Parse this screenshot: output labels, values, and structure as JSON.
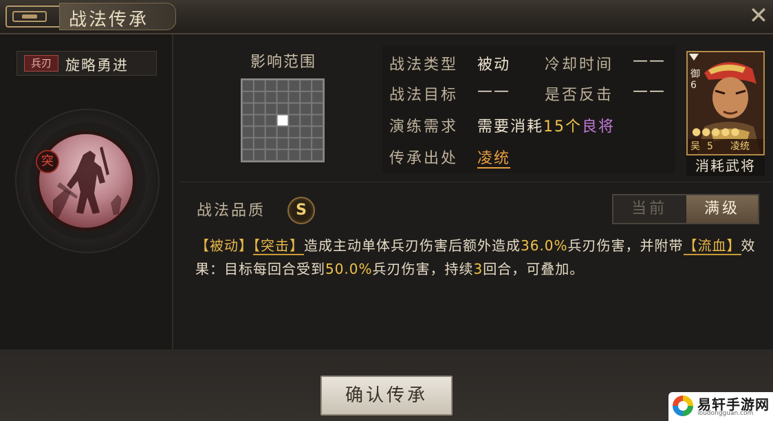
{
  "window": {
    "title": "战法传承"
  },
  "skill": {
    "type_tag": "兵刃",
    "name": "旋略勇进",
    "badge": "突"
  },
  "range": {
    "label": "影响范围",
    "grid_rows": 7,
    "grid_cols": 7,
    "highlight_cell": [
      3,
      3
    ]
  },
  "props": {
    "type_label": "战法类型",
    "type_value": "被动",
    "cooldown_label": "冷却时间",
    "cooldown_value": "——",
    "target_label": "战法目标",
    "target_value": "——",
    "counter_label": "是否反击",
    "counter_value": "——",
    "train_label": "演练需求",
    "train_prefix": "需要消耗",
    "train_count": "15个",
    "train_item": "良将",
    "source_label": "传承出处",
    "source_value": "凌统"
  },
  "general_card": {
    "faction_label": "御",
    "cost": "6",
    "stars": "●●●●●",
    "camp": "吴",
    "level": "5",
    "name": "凌统",
    "caption": "消耗武将"
  },
  "quality": {
    "label": "战法品质",
    "grade": "S"
  },
  "toggle": {
    "current": "当前",
    "max": "满级",
    "selected": "满级"
  },
  "description": {
    "tag1": "【被动】",
    "tag2": "【突击】",
    "part1": "造成主动单体兵刃伤害后额外造成",
    "val1": "36.0%",
    "part2": "兵刃伤害，并附带",
    "tag3": "【流血】",
    "part3": "效果：目标每回合受到",
    "val2": "50.0%",
    "part4": "兵刃伤害，持续",
    "val3": "3",
    "part5": "回合，可叠加。"
  },
  "confirm_button": "确认传承",
  "watermark": {
    "name": "易轩手游网",
    "url": "ibudongguan.com"
  },
  "colors": {
    "accent_gold": "#f0c24a",
    "accent_purple": "#c07ad6",
    "accent_orange": "#e8a040",
    "panel_bg": "#1e1c1a"
  }
}
